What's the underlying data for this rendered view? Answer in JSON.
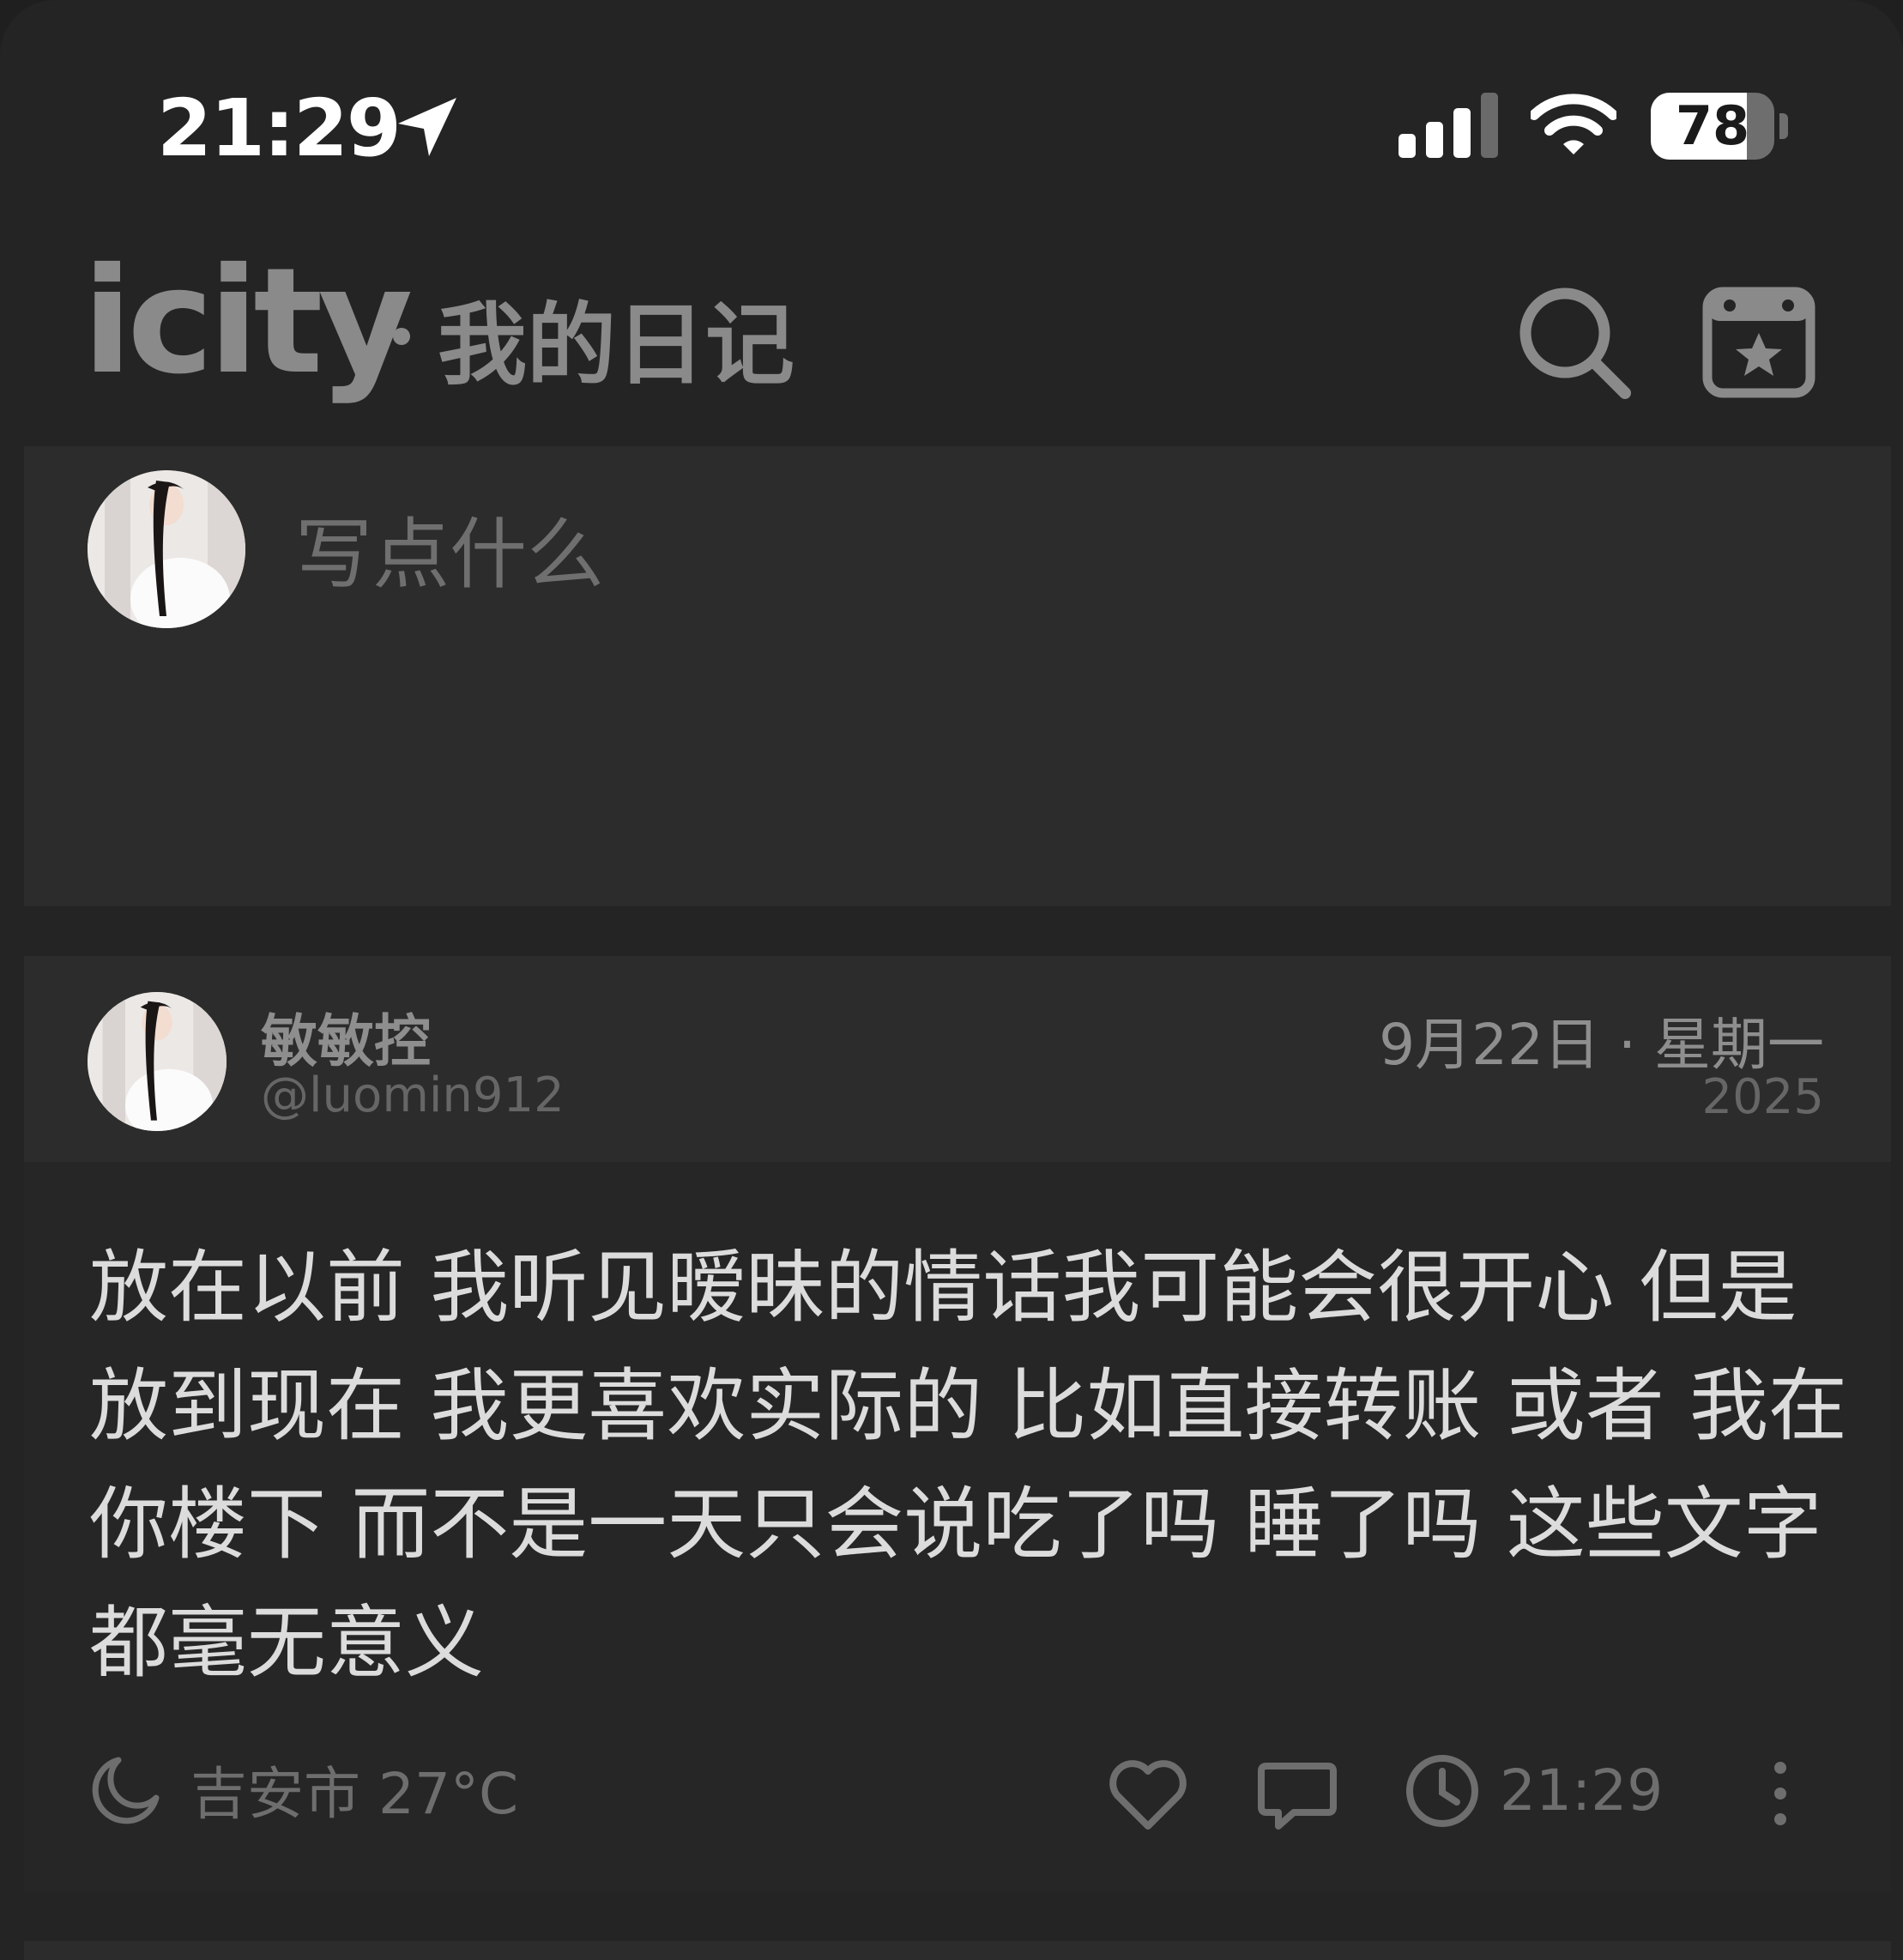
{
  "status_bar": {
    "time": "21:29",
    "battery": "78",
    "battery_level": 0.78,
    "icons": [
      "location-arrow-icon",
      "cellular-signal-icon",
      "wifi-icon",
      "battery-icon"
    ]
  },
  "header": {
    "brand": "icity",
    "title": "我的日记",
    "icons": [
      "search-icon",
      "calendar-star-icon"
    ]
  },
  "compose": {
    "placeholder": "写点什么"
  },
  "post": {
    "author_name": "敏敏控",
    "author_handle": "@luomin912",
    "date": "9月22日 · 星期一",
    "year": "2025",
    "body": "放在以前 我听见暧昧的情话我可能会很开心 但是放到现在 我更喜欢实际的 比如直接转账 或者 我在你楼下 而不是一天只会说吃了吗 睡了吗 这些文字都毫无意义",
    "weather": "吉安市 27°C",
    "time": "21:29",
    "icons": [
      "moon-icon",
      "heart-icon",
      "comment-icon",
      "clock-icon",
      "more-icon"
    ]
  },
  "colors": {
    "background": "#242424",
    "card": "#2c2c2c",
    "muted_text": "#8a8a8a",
    "body_text": "#dcdcdc"
  }
}
